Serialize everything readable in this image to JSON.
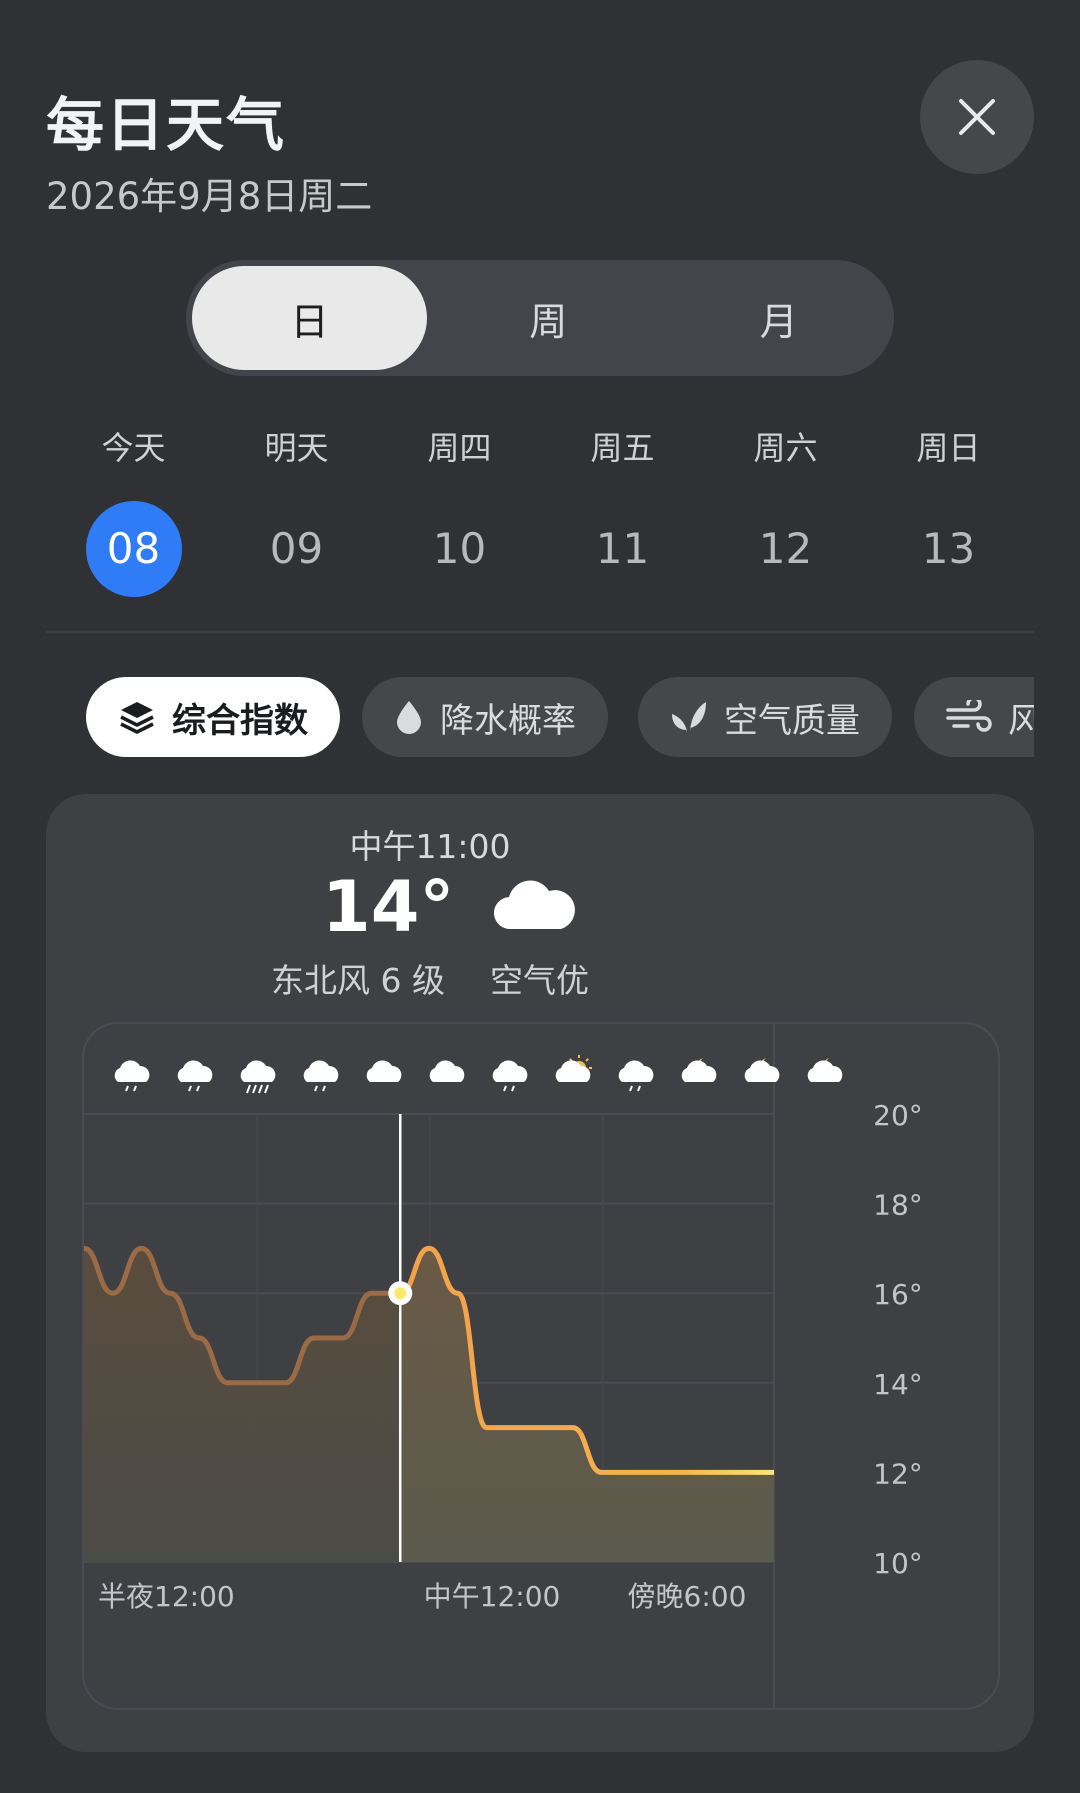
{
  "header": {
    "title": "每日天气",
    "date": "2026年9月8日周二"
  },
  "segments": [
    {
      "label": "日",
      "active": true
    },
    {
      "label": "周",
      "active": false
    },
    {
      "label": "月",
      "active": false
    }
  ],
  "days": [
    {
      "label": "今天",
      "num": "08",
      "active": true
    },
    {
      "label": "明天",
      "num": "09",
      "active": false
    },
    {
      "label": "周四",
      "num": "10",
      "active": false
    },
    {
      "label": "周五",
      "num": "11",
      "active": false
    },
    {
      "label": "周六",
      "num": "12",
      "active": false
    },
    {
      "label": "周日",
      "num": "13",
      "active": false
    }
  ],
  "chips": [
    {
      "label": "综合指数",
      "icon": "layers-icon",
      "active": true
    },
    {
      "label": "降水概率",
      "icon": "drop-icon",
      "active": false
    },
    {
      "label": "空气质量",
      "icon": "leaf-icon",
      "active": false
    },
    {
      "label": "风",
      "icon": "wind-icon",
      "active": false
    }
  ],
  "current": {
    "time": "中午11:00",
    "temp": "14°",
    "icon": "cloud-icon",
    "wind": "东北风 6 级",
    "air": "空气优"
  },
  "colors": {
    "accent": "#2f7cf6",
    "line_warm": "#f4a14a",
    "line_yellow": "#ffe27a",
    "past_line": "#9a6b45"
  },
  "chart_data": {
    "type": "area",
    "x": [
      0,
      1,
      2,
      3,
      4,
      5,
      6,
      7,
      8,
      9,
      10,
      11,
      12,
      13,
      14,
      15,
      16,
      17,
      18,
      19,
      20,
      21,
      22,
      23,
      24
    ],
    "values": [
      17,
      16,
      17,
      16,
      15,
      14,
      14,
      14,
      15,
      15,
      16,
      16,
      17,
      16,
      13,
      13,
      13,
      13,
      12,
      12,
      12,
      12,
      12,
      12,
      12
    ],
    "current_index": 11,
    "y_ticks": [
      "20°",
      "18°",
      "16°",
      "14°",
      "12°",
      "10°"
    ],
    "ylim": [
      10,
      20
    ],
    "x_labels": [
      "半夜12:00",
      "中午12:00",
      "傍晚6:00"
    ],
    "hour_icons": [
      "rain-light-icon",
      "rain-light-icon",
      "rain-heavy-icon",
      "rain-light-icon",
      "cloud-icon",
      "cloud-icon",
      "rain-light-icon",
      "sun-cloud-icon",
      "rain-light-icon",
      "moon-cloud-icon",
      "moon-cloud-icon",
      "moon-cloud-icon"
    ]
  }
}
